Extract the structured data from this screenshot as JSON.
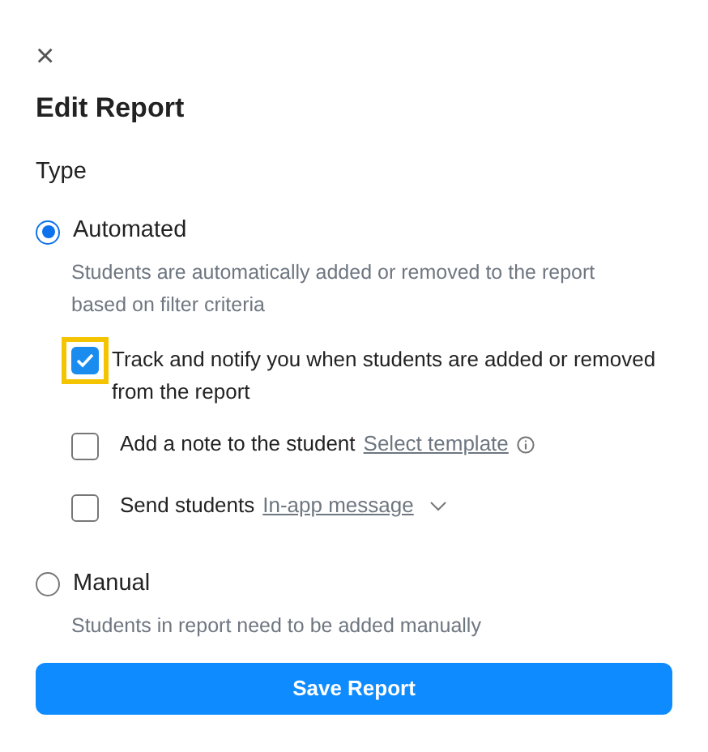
{
  "dialog": {
    "close": "×",
    "title": "Edit Report"
  },
  "type_label": "Type",
  "types": [
    {
      "label": "Automated",
      "selected": true,
      "description": "Students are automatically added or removed to the report based on filter criteria",
      "options": [
        {
          "kind": "plain",
          "text": "Track and notify you when students are added or removed from the report",
          "checked": true,
          "highlighted": true
        },
        {
          "kind": "info",
          "text": "Add a note to the student",
          "link": "Select template",
          "checked": false,
          "highlighted": false
        },
        {
          "kind": "dropdown",
          "text": "Send students",
          "link": "In-app message",
          "checked": false,
          "highlighted": false
        }
      ]
    },
    {
      "label": "Manual",
      "selected": false,
      "description": "Students in report need to be added manually"
    }
  ],
  "save_button": "Save Report"
}
